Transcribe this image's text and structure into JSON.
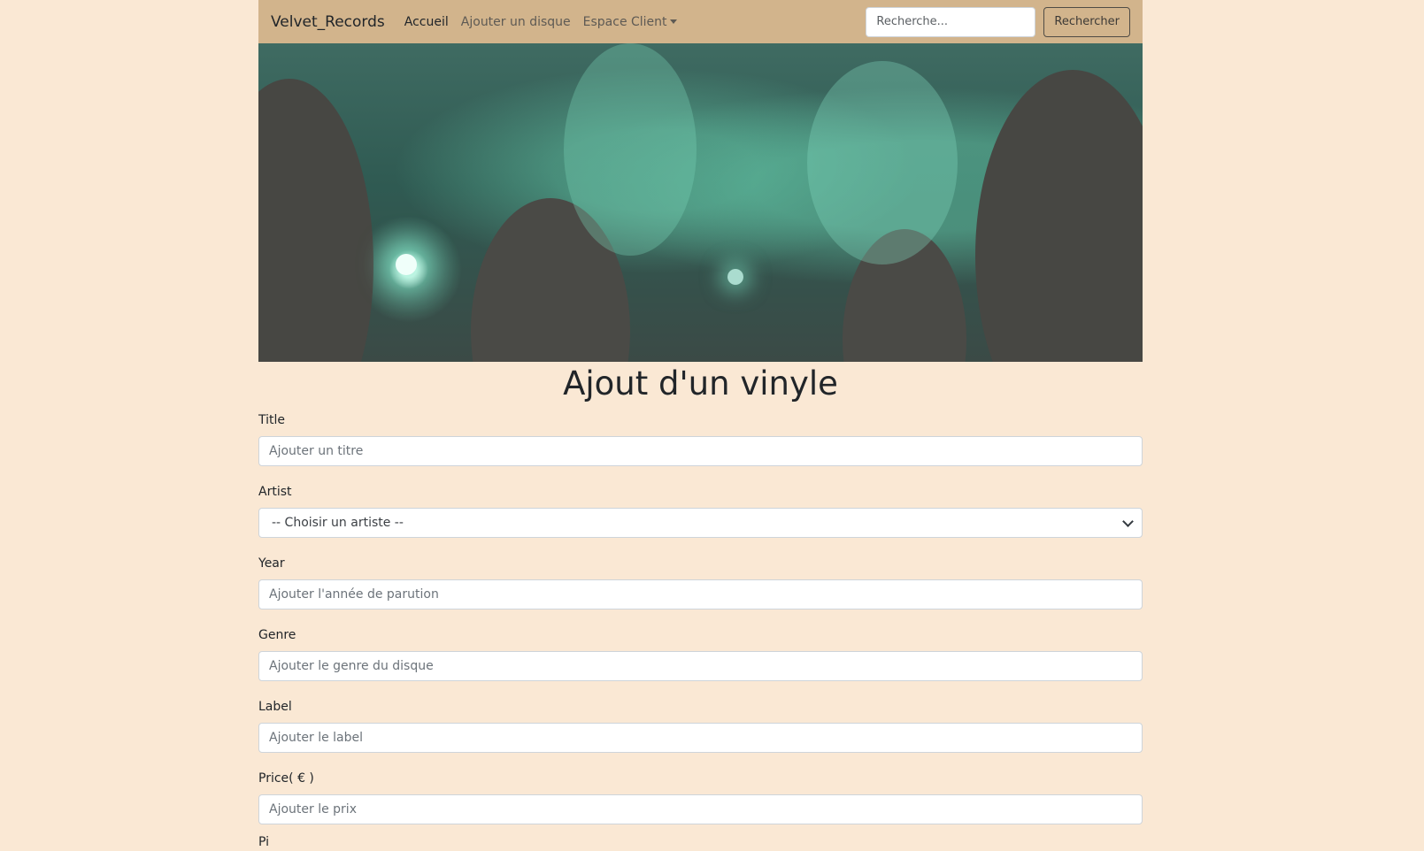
{
  "navbar": {
    "brand": "Velvet_Records",
    "links": [
      {
        "label": "Accueil",
        "active": true
      },
      {
        "label": "Ajouter un disque",
        "active": false
      },
      {
        "label": "Espace Client",
        "active": false,
        "dropdown": true
      }
    ],
    "search": {
      "placeholder": "Recherche...",
      "value": "",
      "button_label": "Rechercher"
    },
    "colors": {
      "background": "#D2B48C"
    }
  },
  "hero": {
    "icon": "concert-photo"
  },
  "form": {
    "title": "Ajout d'un vinyle",
    "fields": {
      "title": {
        "label": "Title",
        "placeholder": "Ajouter un titre"
      },
      "artist": {
        "label": "Artist",
        "selected": "-- Choisir un artiste --"
      },
      "year": {
        "label": "Year",
        "placeholder": "Ajouter l'année de parution"
      },
      "genre": {
        "label": "Genre",
        "placeholder": "Ajouter le genre du disque"
      },
      "label": {
        "label": "Label",
        "placeholder": "Ajouter le label"
      },
      "price": {
        "label": "Price( € )",
        "placeholder": "Ajouter le prix"
      }
    },
    "next_label_partial": "Pi"
  },
  "colors": {
    "page_background": "#FAE8D4"
  }
}
